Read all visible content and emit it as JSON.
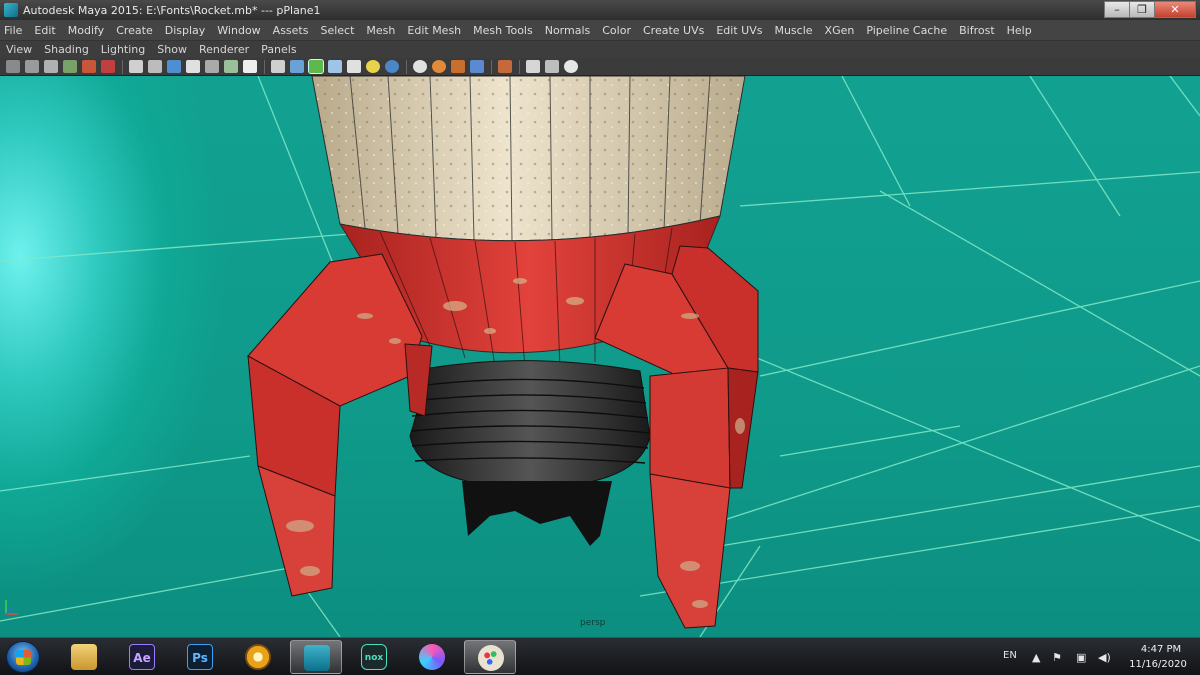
{
  "window": {
    "title": "Autodesk Maya 2015: E:\\Fonts\\Rocket.mb*   ---   pPlane1",
    "controls": {
      "minimize": "–",
      "maximize": "❐",
      "close": "✕"
    }
  },
  "main_menu": [
    "File",
    "Edit",
    "Modify",
    "Create",
    "Display",
    "Window",
    "Assets",
    "Select",
    "Mesh",
    "Edit Mesh",
    "Mesh Tools",
    "Normals",
    "Color",
    "Create UVs",
    "Edit UVs",
    "Muscle",
    "XGen",
    "Pipeline Cache",
    "Bifrost",
    "Help"
  ],
  "panel_menu": [
    "View",
    "Shading",
    "Lighting",
    "Show",
    "Renderer",
    "Panels"
  ],
  "viewport": {
    "camera_label": "persp",
    "colors": {
      "background": "#12a191",
      "grid_line": "#7fe9c8",
      "rocket_red": "#d8322e",
      "rocket_cream": "#d8ccb0",
      "nozzle": "#2a2a2a"
    }
  },
  "taskbar": {
    "apps": [
      {
        "name": "windows-explorer",
        "label": ""
      },
      {
        "name": "after-effects",
        "label": "Ae"
      },
      {
        "name": "photoshop",
        "label": "Ps"
      },
      {
        "name": "browser",
        "label": ""
      },
      {
        "name": "maya",
        "label": "maya"
      },
      {
        "name": "nox",
        "label": "nox"
      },
      {
        "name": "media-app",
        "label": ""
      },
      {
        "name": "paint",
        "label": ""
      }
    ],
    "tray": {
      "language": "EN",
      "time": "4:47 PM",
      "date": "11/16/2020"
    }
  }
}
